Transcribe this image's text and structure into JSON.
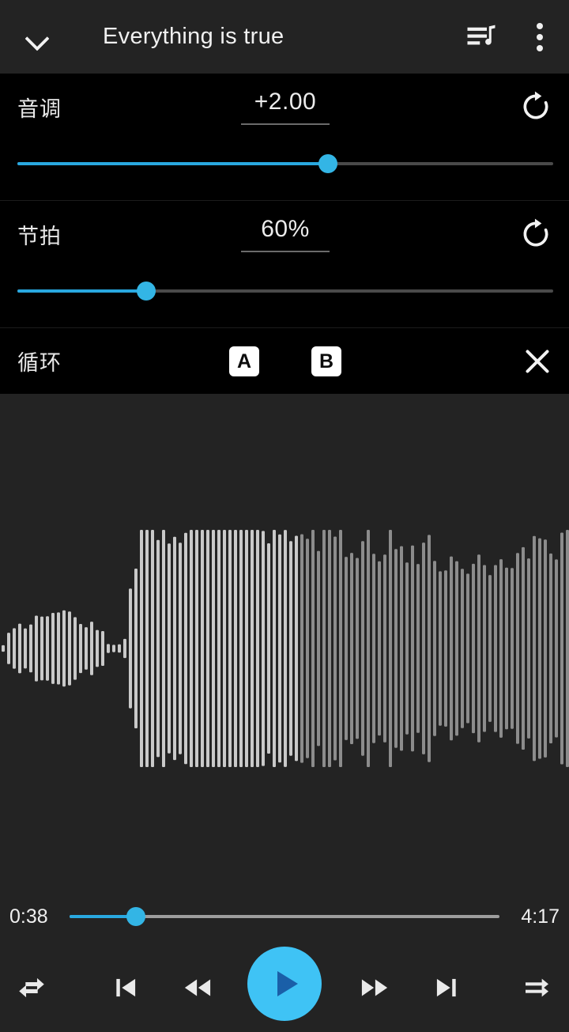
{
  "header": {
    "collapse_icon": "chevron-down-icon",
    "title": "Everything is true",
    "queue_icon": "playlist-queue-icon",
    "menu_icon": "overflow-menu-icon"
  },
  "pitch": {
    "label": "音调",
    "value": "+2.00",
    "reset_icon": "reset-icon",
    "slider_percent": 58
  },
  "tempo": {
    "label": "节拍",
    "value": "60%",
    "reset_icon": "reset-icon",
    "slider_percent": 24
  },
  "loop": {
    "label": "循环",
    "point_a": "A",
    "point_b": "B",
    "close_icon": "close-icon"
  },
  "waveform": {
    "played_color": "#c9c9c9",
    "remaining_color": "#8c8c8c",
    "background": "#232323",
    "played_until_percent": 52
  },
  "seek": {
    "current_time": "0:38",
    "total_time": "4:17",
    "progress_percent": 15.4
  },
  "transport": {
    "repeat_icon": "repeat-icon",
    "previous_icon": "skip-previous-icon",
    "rewind_icon": "rewind-icon",
    "play_icon": "play-icon",
    "fast_forward_icon": "fast-forward-icon",
    "next_icon": "skip-next-icon",
    "shuffle_icon": "shuffle-icon"
  },
  "colors": {
    "accent": "#33B5E5",
    "play_button": "#3FC3F5",
    "play_glyph": "#1A5FA8",
    "panel_bg": "#000000",
    "bar_bg": "#232323"
  }
}
